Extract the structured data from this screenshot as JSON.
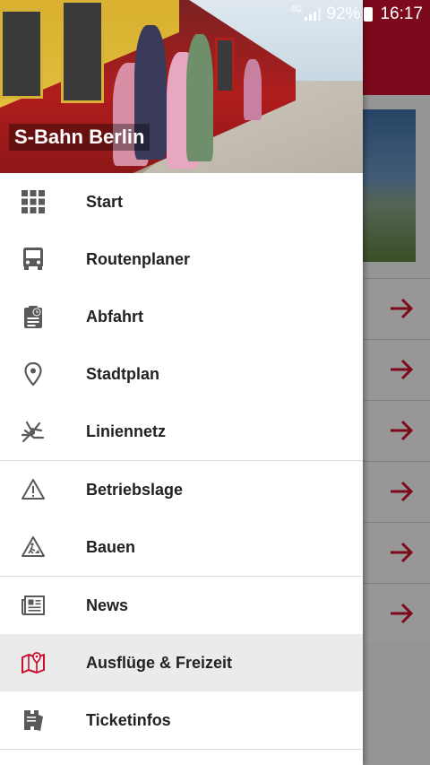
{
  "status_bar": {
    "network": "4G",
    "battery": "92%",
    "time": "16:17"
  },
  "drawer": {
    "title": "S-Bahn Berlin",
    "groups": [
      [
        {
          "label": "Start",
          "icon": "grid-icon"
        },
        {
          "label": "Routenplaner",
          "icon": "bus-icon"
        },
        {
          "label": "Abfahrt",
          "icon": "clipboard-clock-icon"
        },
        {
          "label": "Stadtplan",
          "icon": "location-pin-icon"
        },
        {
          "label": "Liniennetz",
          "icon": "network-map-icon"
        }
      ],
      [
        {
          "label": "Betriebslage",
          "icon": "warning-icon"
        },
        {
          "label": "Bauen",
          "icon": "construction-icon"
        }
      ],
      [
        {
          "label": "News",
          "icon": "newspaper-icon"
        },
        {
          "label": "Ausflüge & Freizeit",
          "icon": "map-icon",
          "active": true
        },
        {
          "label": "Ticketinfos",
          "icon": "ticket-icon"
        }
      ]
    ]
  },
  "colors": {
    "brand_red": "#c8102e",
    "icon_gray": "#5a5a5a",
    "active_bg": "#ebebeb"
  }
}
